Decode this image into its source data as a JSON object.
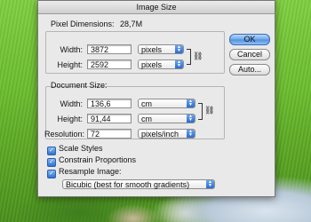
{
  "window": {
    "title": "Image Size"
  },
  "pixel_dimensions": {
    "title": "Pixel Dimensions:",
    "size": "28,7M",
    "width": {
      "label": "Width:",
      "value": "3872",
      "unit": "pixels"
    },
    "height": {
      "label": "Height:",
      "value": "2592",
      "unit": "pixels"
    }
  },
  "document_size": {
    "title": "Document Size:",
    "width": {
      "label": "Width:",
      "value": "136,6",
      "unit": "cm"
    },
    "height": {
      "label": "Height:",
      "value": "91,44",
      "unit": "cm"
    },
    "resolution": {
      "label": "Resolution:",
      "value": "72",
      "unit": "pixels/inch"
    }
  },
  "options": {
    "scale_styles": {
      "label": "Scale Styles",
      "checked": true
    },
    "constrain_proportions": {
      "label": "Constrain Proportions",
      "checked": true
    },
    "resample_image": {
      "label": "Resample Image:",
      "checked": true
    },
    "resample_method": "Bicubic (best for smooth gradients)"
  },
  "buttons": {
    "ok": "OK",
    "cancel": "Cancel",
    "auto": "Auto..."
  },
  "colors": {
    "accent": "#4f8fe0",
    "dialog_bg": "#e9e9e9"
  },
  "icons": {
    "link": "chain-link-icon",
    "select_arrows": "up-down-arrows-icon",
    "checkmark": "checkmark-icon"
  }
}
